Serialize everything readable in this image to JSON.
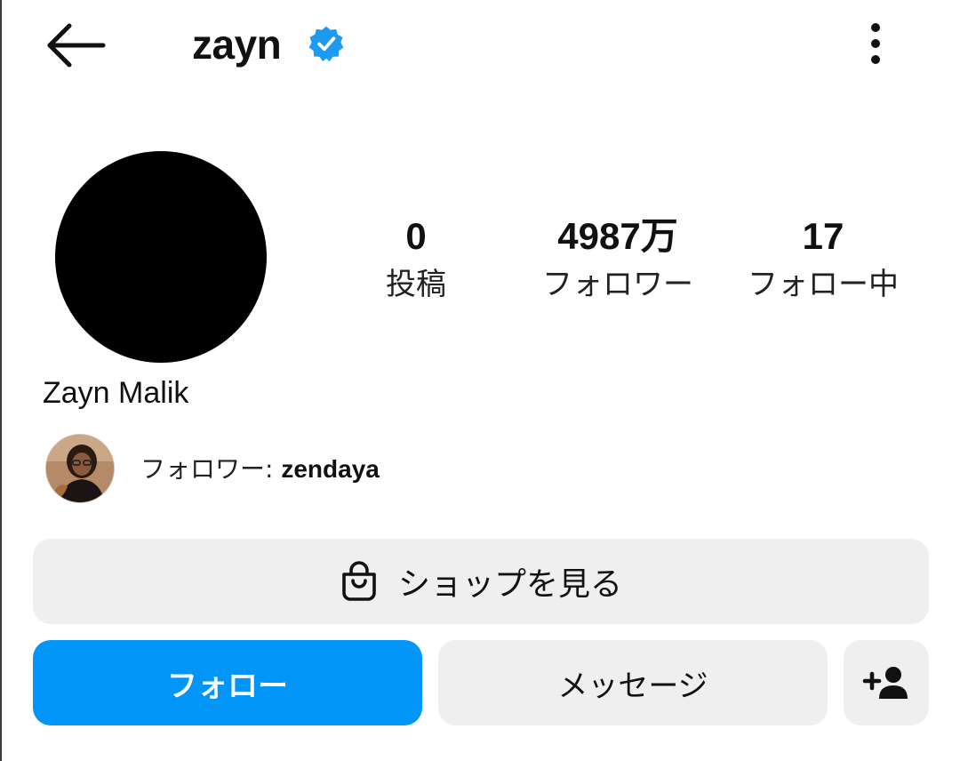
{
  "header": {
    "username": "zayn",
    "verified": true,
    "back_icon": "back-arrow-icon",
    "more_icon": "more-vertical-icon"
  },
  "profile": {
    "full_name": "Zayn Malik",
    "stats": [
      {
        "value": "0",
        "label": "投稿"
      },
      {
        "value": "4987万",
        "label": "フォロワー"
      },
      {
        "value": "17",
        "label": "フォロー中"
      }
    ]
  },
  "mutual": {
    "prefix": "フォロワー: ",
    "name": "zendaya"
  },
  "buttons": {
    "shop_label": "ショップを見る",
    "follow_label": "フォロー",
    "message_label": "メッセージ",
    "add_user_icon": "add-user-icon"
  },
  "colors": {
    "accent": "#0095f6",
    "verified": "#1d9bf0",
    "button_gray": "#efefef",
    "text": "#111111"
  }
}
